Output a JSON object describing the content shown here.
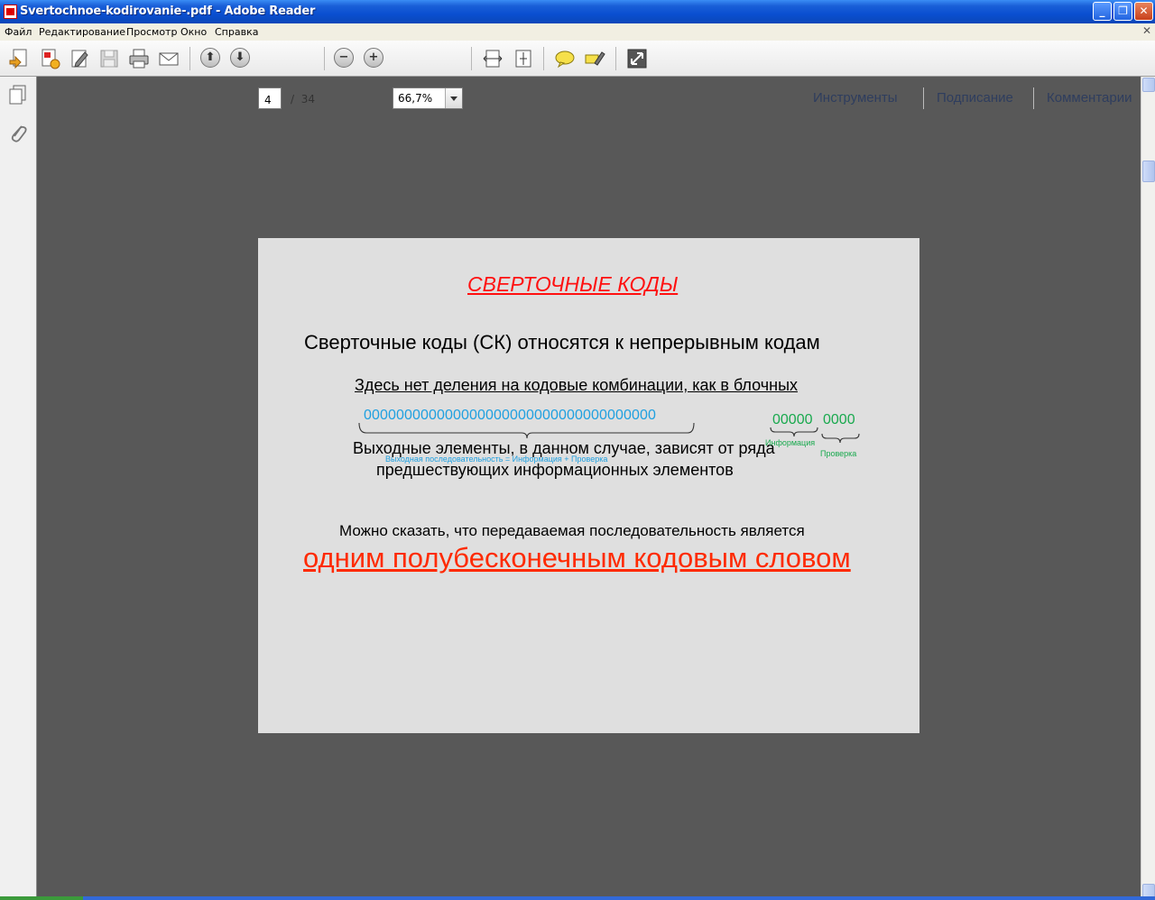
{
  "window": {
    "title": "Svertochnoe-kodirovanie-.pdf - Adobe Reader",
    "controls": {
      "minimize": "_",
      "maximize": "❐",
      "close": "✕"
    }
  },
  "menu": {
    "items": [
      "Файл",
      "Редактирование",
      "Просмотр",
      "Окно",
      "Справка"
    ]
  },
  "toolbar": {
    "page_current": "4",
    "page_separator": "/",
    "page_total": "34",
    "zoom": "66,7%",
    "right_links": [
      "Инструменты",
      "Подписание",
      "Комментарии"
    ],
    "icons": [
      "create-pdf-icon",
      "convert-pdf-icon",
      "edit-icon",
      "save-icon",
      "print-icon",
      "email-icon",
      "page-up-icon",
      "page-down-icon",
      "zoom-out-icon",
      "zoom-in-icon",
      "fit-width-icon",
      "fit-page-icon",
      "comment-icon",
      "highlight-icon",
      "fullscreen-icon"
    ]
  },
  "leftpanel": {
    "icons": [
      "pages-icon",
      "attachment-icon"
    ]
  },
  "slide": {
    "title": "СВЕРТОЧНЫЕ КОДЫ",
    "line1": "Сверточные коды (СК) относятся к непрерывным кодам",
    "line2": "Здесь нет деления на кодовые комбинации, как в блочных",
    "seq_long": "000000000000000000000000000000000000",
    "seq_info": "00000",
    "seq_check": "0000",
    "label_output": "Выходная последовательность = Информация + Проверка",
    "label_info": "Информация",
    "label_check": "Проверка",
    "line3": "Выходные элементы, в данном случае, зависят от ряда",
    "line4": "предшествующих информационных элементов",
    "line5": "Можно сказать, что передаваемая последовательность является",
    "line6": "одним полубесконечным кодовым словом"
  },
  "colors": {
    "title_bar": "#0a4fd0",
    "doc_background": "#585858",
    "slide_bg": "#dfdfdf",
    "title_red": "#ff1010",
    "accent_blue": "#1fa0e0",
    "accent_green": "#19a94e",
    "emphasis_red": "#ff2a00"
  }
}
